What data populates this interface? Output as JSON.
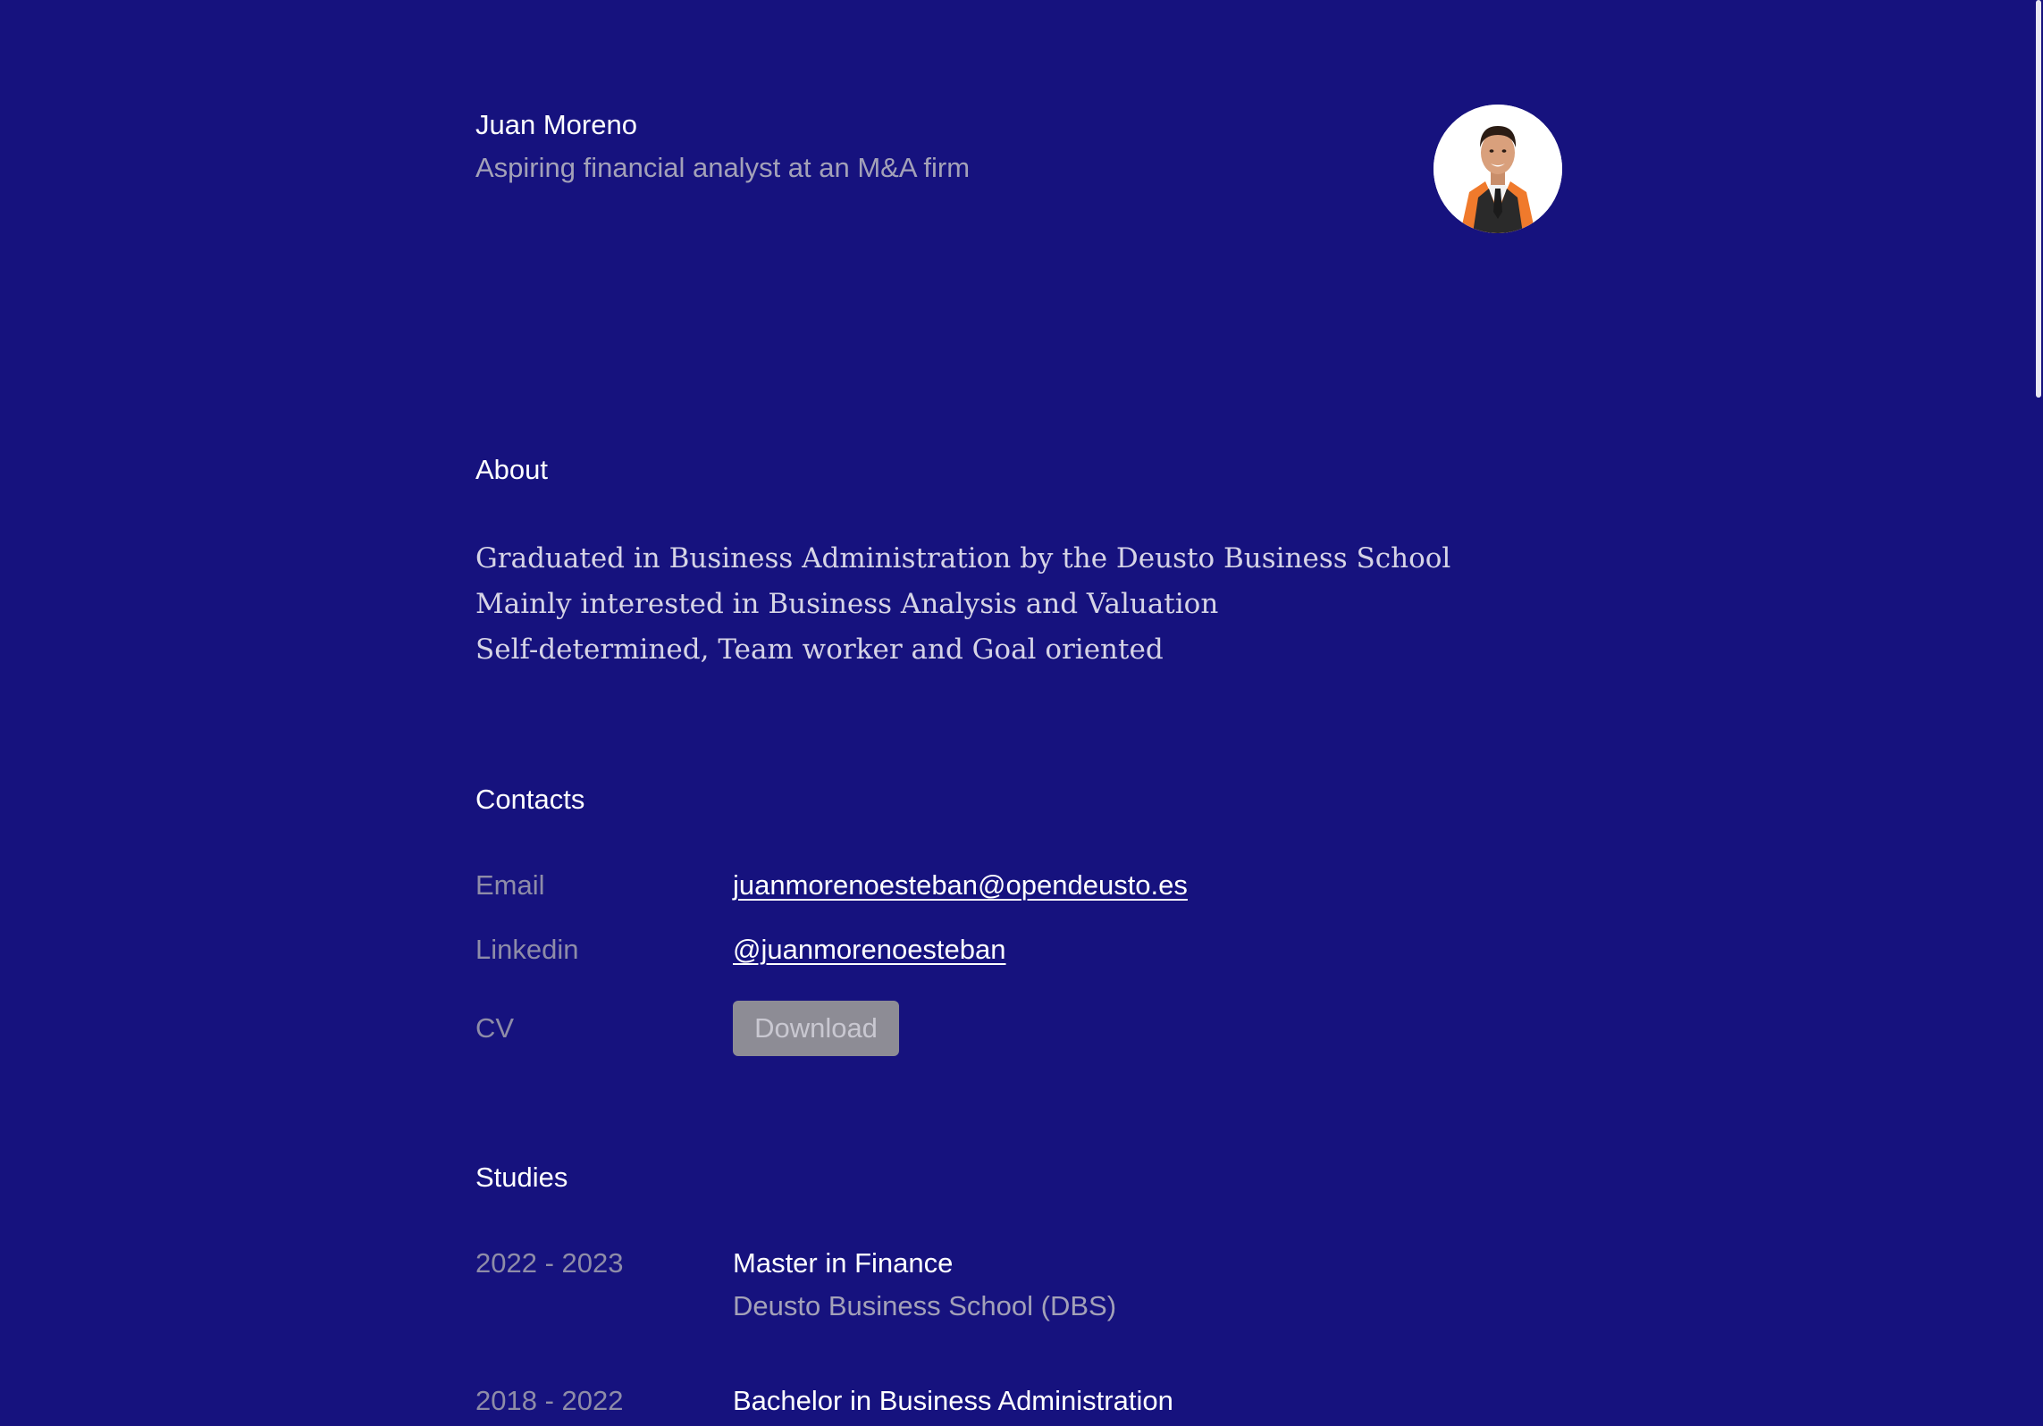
{
  "header": {
    "name": "Juan Moreno",
    "tagline": "Aspiring financial analyst at an M&A firm",
    "avatar_icon": "portrait-photo"
  },
  "about": {
    "title": "About",
    "lines": [
      "Graduated in Business Administration by the Deusto Business School",
      "Mainly interested in Business Analysis and Valuation",
      "Self-determined, Team worker and Goal oriented"
    ]
  },
  "contacts": {
    "title": "Contacts",
    "email_label": "Email",
    "email_value": "juanmorenoesteban@opendeusto.es",
    "linkedin_label": "Linkedin",
    "linkedin_value": "@juanmorenoesteban",
    "cv_label": "CV",
    "cv_button": "Download"
  },
  "studies": {
    "title": "Studies",
    "items": [
      {
        "years": "2022 - 2023",
        "degree": "Master in Finance",
        "school": "Deusto Business School (DBS)"
      },
      {
        "years": "2018 - 2022",
        "degree": "Bachelor in Business Administration",
        "school": ""
      }
    ]
  },
  "colors": {
    "background": "#16127e",
    "text_primary": "#ffffff",
    "text_muted": "#a3a1b8",
    "button_bg": "#8d8c95"
  }
}
